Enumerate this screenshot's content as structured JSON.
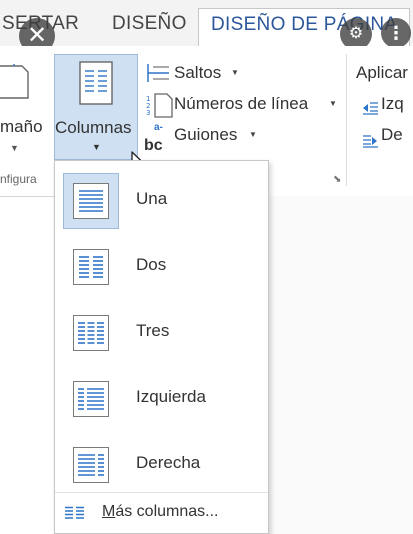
{
  "tabs": {
    "insert": "SERTAR",
    "design": "DISEÑO",
    "page_layout": "DISEÑO DE PÁGINA"
  },
  "ribbon": {
    "size_label": "maño",
    "columns_label": "Columnas",
    "group_config_label": "nfigura",
    "breaks_label": "Saltos",
    "line_numbers_label": "Números de línea",
    "hyphenation_label": "Guiones",
    "apply_label": "Aplicar",
    "indent_left_label": "Izq",
    "indent_right_label": "De"
  },
  "columns_menu": {
    "items": [
      {
        "label": "Una",
        "columns": 1,
        "selected": true
      },
      {
        "label": "Dos",
        "columns": 2,
        "selected": false
      },
      {
        "label": "Tres",
        "columns": 3,
        "selected": false
      },
      {
        "label": "Izquierda",
        "columns": "left",
        "selected": false
      },
      {
        "label": "Derecha",
        "columns": "right",
        "selected": false
      }
    ],
    "more_label_accel": "M",
    "more_label_rest": "ás columnas..."
  },
  "colors": {
    "accent": "#2b579a",
    "selected_bg": "#cfe0f2",
    "icon_blue": "#2e74c8"
  },
  "icons": {
    "close": "close-icon",
    "overlay_a": "settings-icon",
    "overlay_b": "more-icon"
  }
}
